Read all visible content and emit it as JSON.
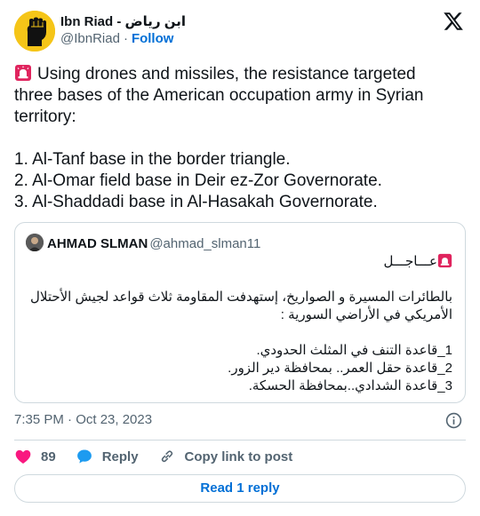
{
  "author": {
    "display_name": "Ibn Riad - ابن رياض",
    "handle": "@IbnRiad",
    "separator": "·",
    "follow_label": "Follow"
  },
  "tweet": {
    "lines": [
      "Using drones and missiles, the resistance targeted",
      "three bases of the American occupation army in Syrian",
      "territory:",
      "",
      "1. Al-Tanf base in the border triangle.",
      "2. Al-Omar field base in Deir ez-Zor Governorate.",
      "3. Al-Shaddadi base in Al-Hasakah Governorate."
    ]
  },
  "quote": {
    "name": "AHMAD SLMAN",
    "handle": "@ahmad_slman11",
    "lines": [
      "عـــاجـــل",
      "",
      "بالطائرات المسيرة و الصواريخ، إستهدفت المقاومة ثلاث قواعد لجيش الأحتلال",
      "الأمريكي في الأراضي السورية :",
      "",
      "1_قاعدة التنف في المثلث الحدودي.",
      "2_قاعدة حقل العمر.. بمحافظة دير الزور.",
      "3_قاعدة الشدادي..بمحافظة الحسكة."
    ]
  },
  "meta": {
    "timestamp": "7:35 PM · Oct 23, 2023"
  },
  "actions": {
    "like_count": "89",
    "reply_label": "Reply",
    "copy_label": "Copy link to post"
  },
  "read_replies_label": "Read 1 reply",
  "colors": {
    "accent": "#006fd6",
    "like": "#f91880",
    "reply_icon": "#1d9bf0",
    "border": "#cfd9de",
    "muted": "#536471"
  },
  "icons": [
    "siren-icon",
    "x-logo-icon",
    "info-icon",
    "heart-icon",
    "reply-bubble-icon",
    "link-icon"
  ]
}
